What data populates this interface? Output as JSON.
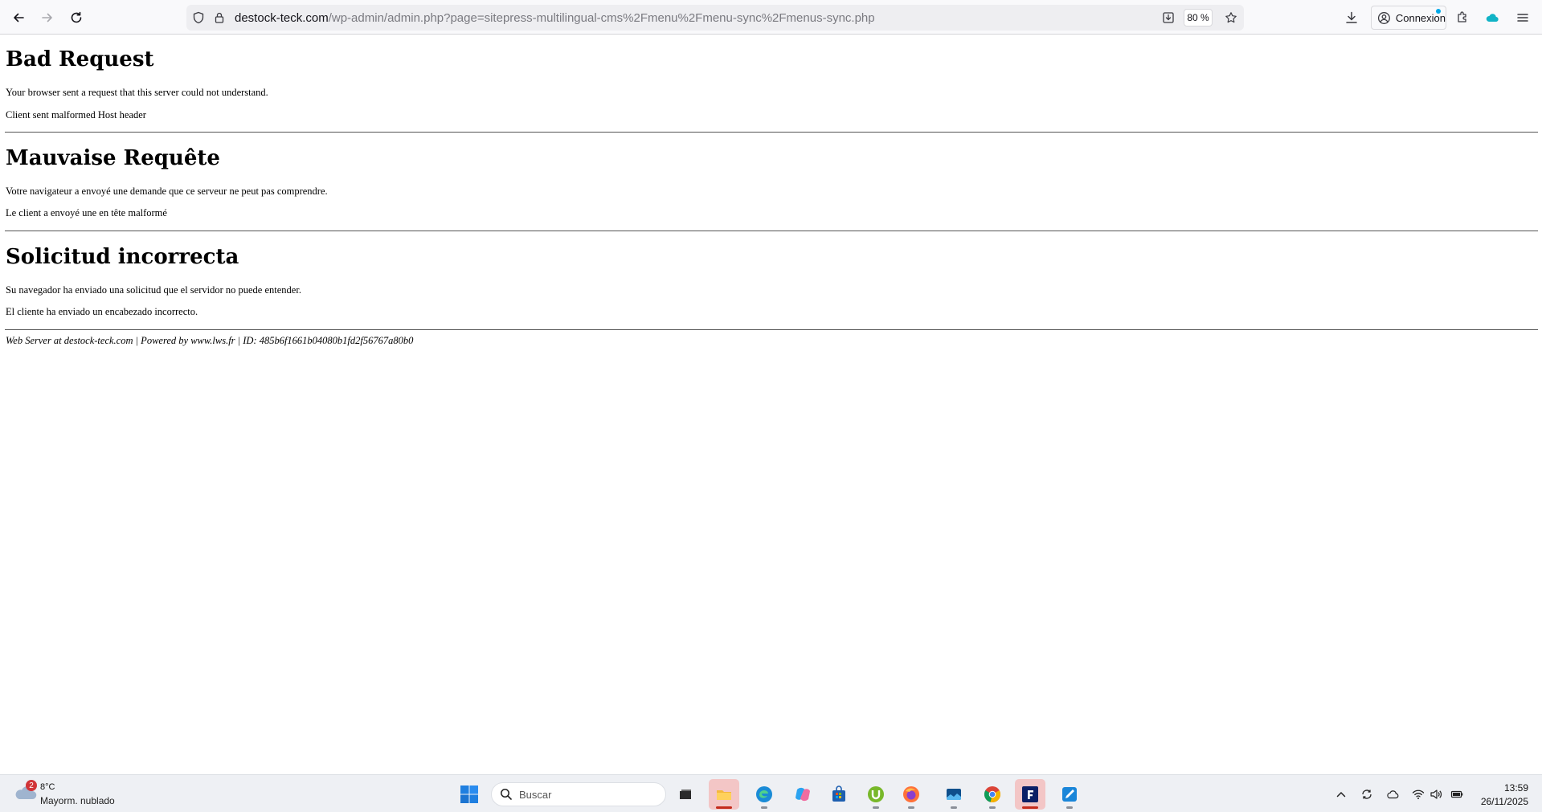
{
  "browser": {
    "url_host": "destock-teck.com",
    "url_path": "/wp-admin/admin.php?page=sitepress-multilingual-cms%2Fmenu%2Fmenu-sync%2Fmenus-sync.php",
    "zoom": "80 %",
    "signin_label": "Connexion",
    "icons": [
      "back-icon",
      "forward-icon",
      "reload-icon",
      "shield-icon",
      "lock-icon",
      "page-save-icon",
      "bookmark-star-icon",
      "downloads-icon",
      "account-icon",
      "extensions-icon",
      "cloud-icon",
      "menu-icon"
    ]
  },
  "page": {
    "sections": [
      {
        "heading": "Bad Request",
        "line1": "Your browser sent a request that this server could not understand.",
        "line2": "Client sent malformed Host header"
      },
      {
        "heading": "Mauvaise Requête",
        "line1": "Votre navigateur a envoyé une demande que ce serveur ne peut pas comprendre.",
        "line2": "Le client a envoyé une en tête malformé"
      },
      {
        "heading": "Solicitud incorrecta",
        "line1": "Su navegador ha enviado una solicitud que el servidor no puede entender.",
        "line2": "El cliente ha enviado un encabezado incorrecto."
      }
    ],
    "footer": "Web Server at destock-teck.com | Powered by www.lws.fr | ID: 485b6f1661b04080b1fd2f56767a80b0"
  },
  "taskbar": {
    "weather_temp": "8°C",
    "weather_desc": "Mayorm. nublado",
    "weather_badge": "2",
    "search_placeholder": "Buscar",
    "clock_time": "13:59",
    "clock_date": "26/11/2025",
    "apps": [
      "task-view",
      "file-explorer",
      "edge",
      "copilot",
      "microsoft-store",
      "utorrent",
      "firefox",
      "photos",
      "chrome",
      "filezilla-or-app",
      "paint"
    ],
    "accent": "#0078d4"
  }
}
